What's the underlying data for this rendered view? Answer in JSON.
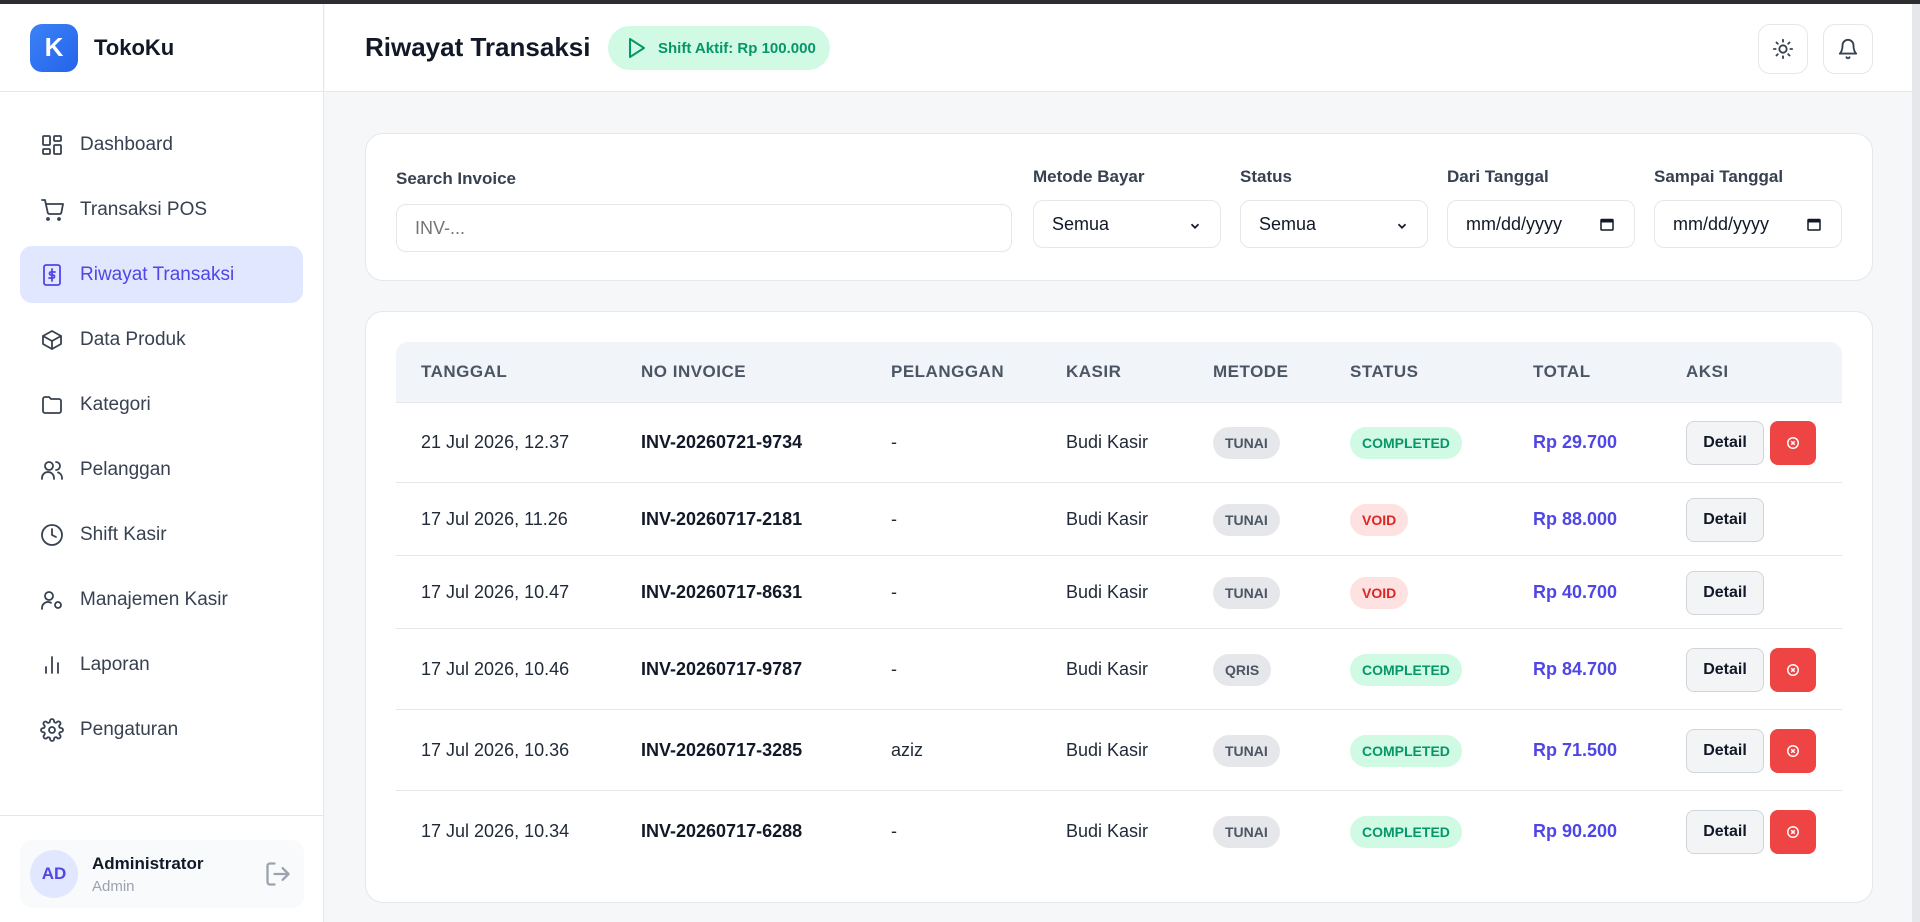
{
  "brand": {
    "logo_letter": "K",
    "name": "TokoKu"
  },
  "sidebar": {
    "items": [
      {
        "label": "Dashboard",
        "icon": "dashboard-icon",
        "active": false
      },
      {
        "label": "Transaksi POS",
        "icon": "cart-icon",
        "active": false
      },
      {
        "label": "Riwayat Transaksi",
        "icon": "receipt-icon",
        "active": true
      },
      {
        "label": "Data Produk",
        "icon": "box-icon",
        "active": false
      },
      {
        "label": "Kategori",
        "icon": "folder-icon",
        "active": false
      },
      {
        "label": "Pelanggan",
        "icon": "users-icon",
        "active": false
      },
      {
        "label": "Shift Kasir",
        "icon": "clock-icon",
        "active": false
      },
      {
        "label": "Manajemen Kasir",
        "icon": "user-cog-icon",
        "active": false
      },
      {
        "label": "Laporan",
        "icon": "bar-chart-icon",
        "active": false
      },
      {
        "label": "Pengaturan",
        "icon": "gear-icon",
        "active": false
      }
    ]
  },
  "user": {
    "initials": "AD",
    "name": "Administrator",
    "role": "Admin"
  },
  "header": {
    "title": "Riwayat Transaksi",
    "shift_badge": "Shift Aktif: Rp 100.000"
  },
  "filters": {
    "search_label": "Search Invoice",
    "search_placeholder": "INV-...",
    "method_label": "Metode Bayar",
    "method_value": "Semua",
    "status_label": "Status",
    "status_value": "Semua",
    "from_label": "Dari Tanggal",
    "from_value": "mm/dd/yyyy",
    "to_label": "Sampai Tanggal",
    "to_value": "mm/dd/yyyy"
  },
  "table": {
    "headers": [
      "TANGGAL",
      "NO INVOICE",
      "PELANGGAN",
      "KASIR",
      "METODE",
      "STATUS",
      "TOTAL",
      "AKSI"
    ],
    "detail_label": "Detail",
    "rows": [
      {
        "date": "21 Jul 2026, 12.37",
        "invoice": "INV-20260721-9734",
        "customer": "-",
        "cashier": "Budi Kasir",
        "method": "TUNAI",
        "status": "COMPLETED",
        "total": "Rp 29.700"
      },
      {
        "date": "17 Jul 2026, 11.26",
        "invoice": "INV-20260717-2181",
        "customer": "-",
        "cashier": "Budi Kasir",
        "method": "TUNAI",
        "status": "VOID",
        "total": "Rp 88.000"
      },
      {
        "date": "17 Jul 2026, 10.47",
        "invoice": "INV-20260717-8631",
        "customer": "-",
        "cashier": "Budi Kasir",
        "method": "TUNAI",
        "status": "VOID",
        "total": "Rp 40.700"
      },
      {
        "date": "17 Jul 2026, 10.46",
        "invoice": "INV-20260717-9787",
        "customer": "-",
        "cashier": "Budi Kasir",
        "method": "QRIS",
        "status": "COMPLETED",
        "total": "Rp 84.700"
      },
      {
        "date": "17 Jul 2026, 10.36",
        "invoice": "INV-20260717-3285",
        "customer": "aziz",
        "cashier": "Budi Kasir",
        "method": "TUNAI",
        "status": "COMPLETED",
        "total": "Rp 71.500"
      },
      {
        "date": "17 Jul 2026, 10.34",
        "invoice": "INV-20260717-6288",
        "customer": "-",
        "cashier": "Budi Kasir",
        "method": "TUNAI",
        "status": "COMPLETED",
        "total": "Rp 90.200"
      }
    ]
  },
  "colors": {
    "accent": "#4f46e5",
    "active_bg": "#e0e7ff",
    "success": "#059669",
    "danger": "#ef4444"
  }
}
